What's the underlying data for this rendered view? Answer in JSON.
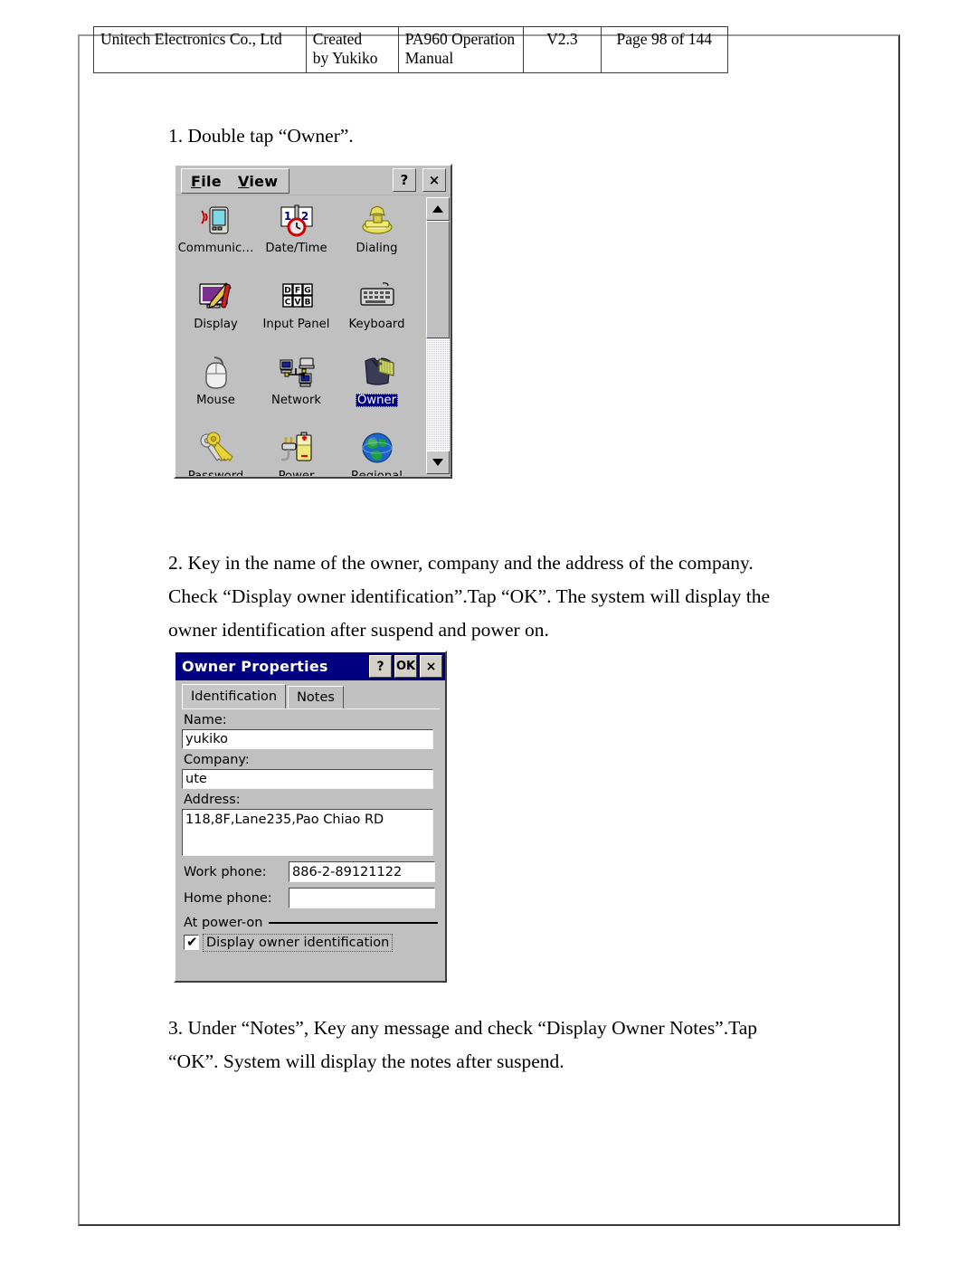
{
  "header_table": {
    "company": "Unitech Electronics Co., Ltd",
    "created_by": "Created\nby Yukiko",
    "manual": "PA960 Operation\nManual",
    "version": "V2.3",
    "page": "Page 98 of 144"
  },
  "steps": {
    "step1": "1. Double tap “Owner”.",
    "step2": "2. Key in the name of the owner, company and the address of the company. Check “Display owner identification”.Tap “OK”. The system will display the owner identification after suspend and power on.",
    "step3": "3. Under “Notes”, Key any message and check “Display Owner Notes”.Tap “OK”. System will display the notes after suspend."
  },
  "control_panel": {
    "menu": {
      "file": "File",
      "file_accel": "F",
      "file_rest": "ile",
      "view": "View",
      "view_accel": "V",
      "view_rest": "iew"
    },
    "help_button": "?",
    "close_button": "×",
    "icons": [
      {
        "id": "communication",
        "label": "Communic…",
        "selected": false
      },
      {
        "id": "date-time",
        "label": "Date/Time",
        "selected": false
      },
      {
        "id": "dialing",
        "label": "Dialing",
        "selected": false
      },
      {
        "id": "display",
        "label": "Display",
        "selected": false
      },
      {
        "id": "input-panel",
        "label": "Input Panel",
        "selected": false
      },
      {
        "id": "keyboard",
        "label": "Keyboard",
        "selected": false
      },
      {
        "id": "mouse",
        "label": "Mouse",
        "selected": false
      },
      {
        "id": "network",
        "label": "Network",
        "selected": false
      },
      {
        "id": "owner",
        "label": "Owner",
        "selected": true
      },
      {
        "id": "password",
        "label": "Password",
        "selected": false
      },
      {
        "id": "power",
        "label": "Power",
        "selected": false
      },
      {
        "id": "regional",
        "label": "Regional",
        "selected": false
      }
    ],
    "input_panel_keys": [
      "D",
      "F",
      "G",
      "C",
      "V",
      "B"
    ],
    "date_time_digits": [
      "1",
      "2"
    ],
    "colors": {
      "selection": "#000080",
      "window_face": "#c0c0c0"
    }
  },
  "owner_properties": {
    "title": "Owner Properties",
    "titlebar_buttons": {
      "help": "?",
      "ok": "OK",
      "close": "×"
    },
    "tabs": [
      {
        "label": "Identification",
        "active": true
      },
      {
        "label": "Notes",
        "active": false
      }
    ],
    "fields": {
      "name_label": "Name:",
      "name_value": "yukiko",
      "company_label": "Company:",
      "company_value": "ute",
      "address_label": "Address:",
      "address_value": "118,8F,Lane235,Pao Chiao RD",
      "work_phone_label": "Work phone:",
      "work_phone_value": "886-2-89121122",
      "home_phone_label": "Home phone:",
      "home_phone_value": ""
    },
    "group": {
      "at_power_on_label": "At power-on",
      "checkbox_label": "Display owner identification",
      "checkbox_checked": true,
      "checkbox_tick": "✔"
    },
    "colors": {
      "titlebar": "#000080",
      "titlebar_text": "#ffffff"
    }
  }
}
